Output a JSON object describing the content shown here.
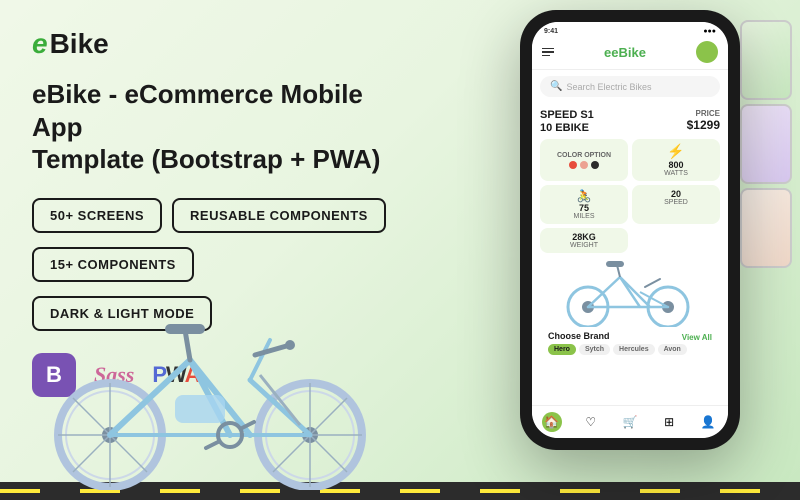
{
  "app": {
    "logo_e": "e",
    "logo_bike": "Bike",
    "title_line1": "eBike - eCommerce Mobile App",
    "title_line2": "Template (Bootstrap + PWA)"
  },
  "badges": [
    {
      "id": "screens",
      "label": "50+ SCREENS"
    },
    {
      "id": "reusable",
      "label": "REUSABLE COMPONENTS"
    },
    {
      "id": "components",
      "label": "15+ COMPONENTS"
    },
    {
      "id": "darklight",
      "label": "DARK & LIGHT MODE"
    }
  ],
  "tech": {
    "bootstrap_symbol": "B",
    "sass_label": "Sass",
    "pwa_label": "PWA"
  },
  "phone": {
    "app_name": "eBike",
    "search_placeholder": "Search Electric Bikes",
    "product_name_line1": "SPEED S1",
    "product_name_line2": "10 EBIKE",
    "price_label": "PRICE",
    "price": "$1299",
    "specs": [
      {
        "label": "COLOR OPTION",
        "value": ""
      },
      {
        "label": "WATTS",
        "value": "800"
      },
      {
        "label": "MILES",
        "value": "75"
      },
      {
        "label": "SPEED",
        "value": "20"
      },
      {
        "label": "WEIGHT",
        "value": "28KG"
      }
    ],
    "choose_brand": "Choose Brand",
    "view_all": "View All",
    "brands": [
      "Hero",
      "Sytch",
      "Hercules",
      "Avon"
    ]
  },
  "colors": {
    "accent_green": "#8bc34a",
    "dark": "#1a1a1a",
    "bg_light": "#f0f8e8",
    "purple": "#7952b3",
    "sass_pink": "#cd6799",
    "pwa_blue": "#3d4db7"
  }
}
